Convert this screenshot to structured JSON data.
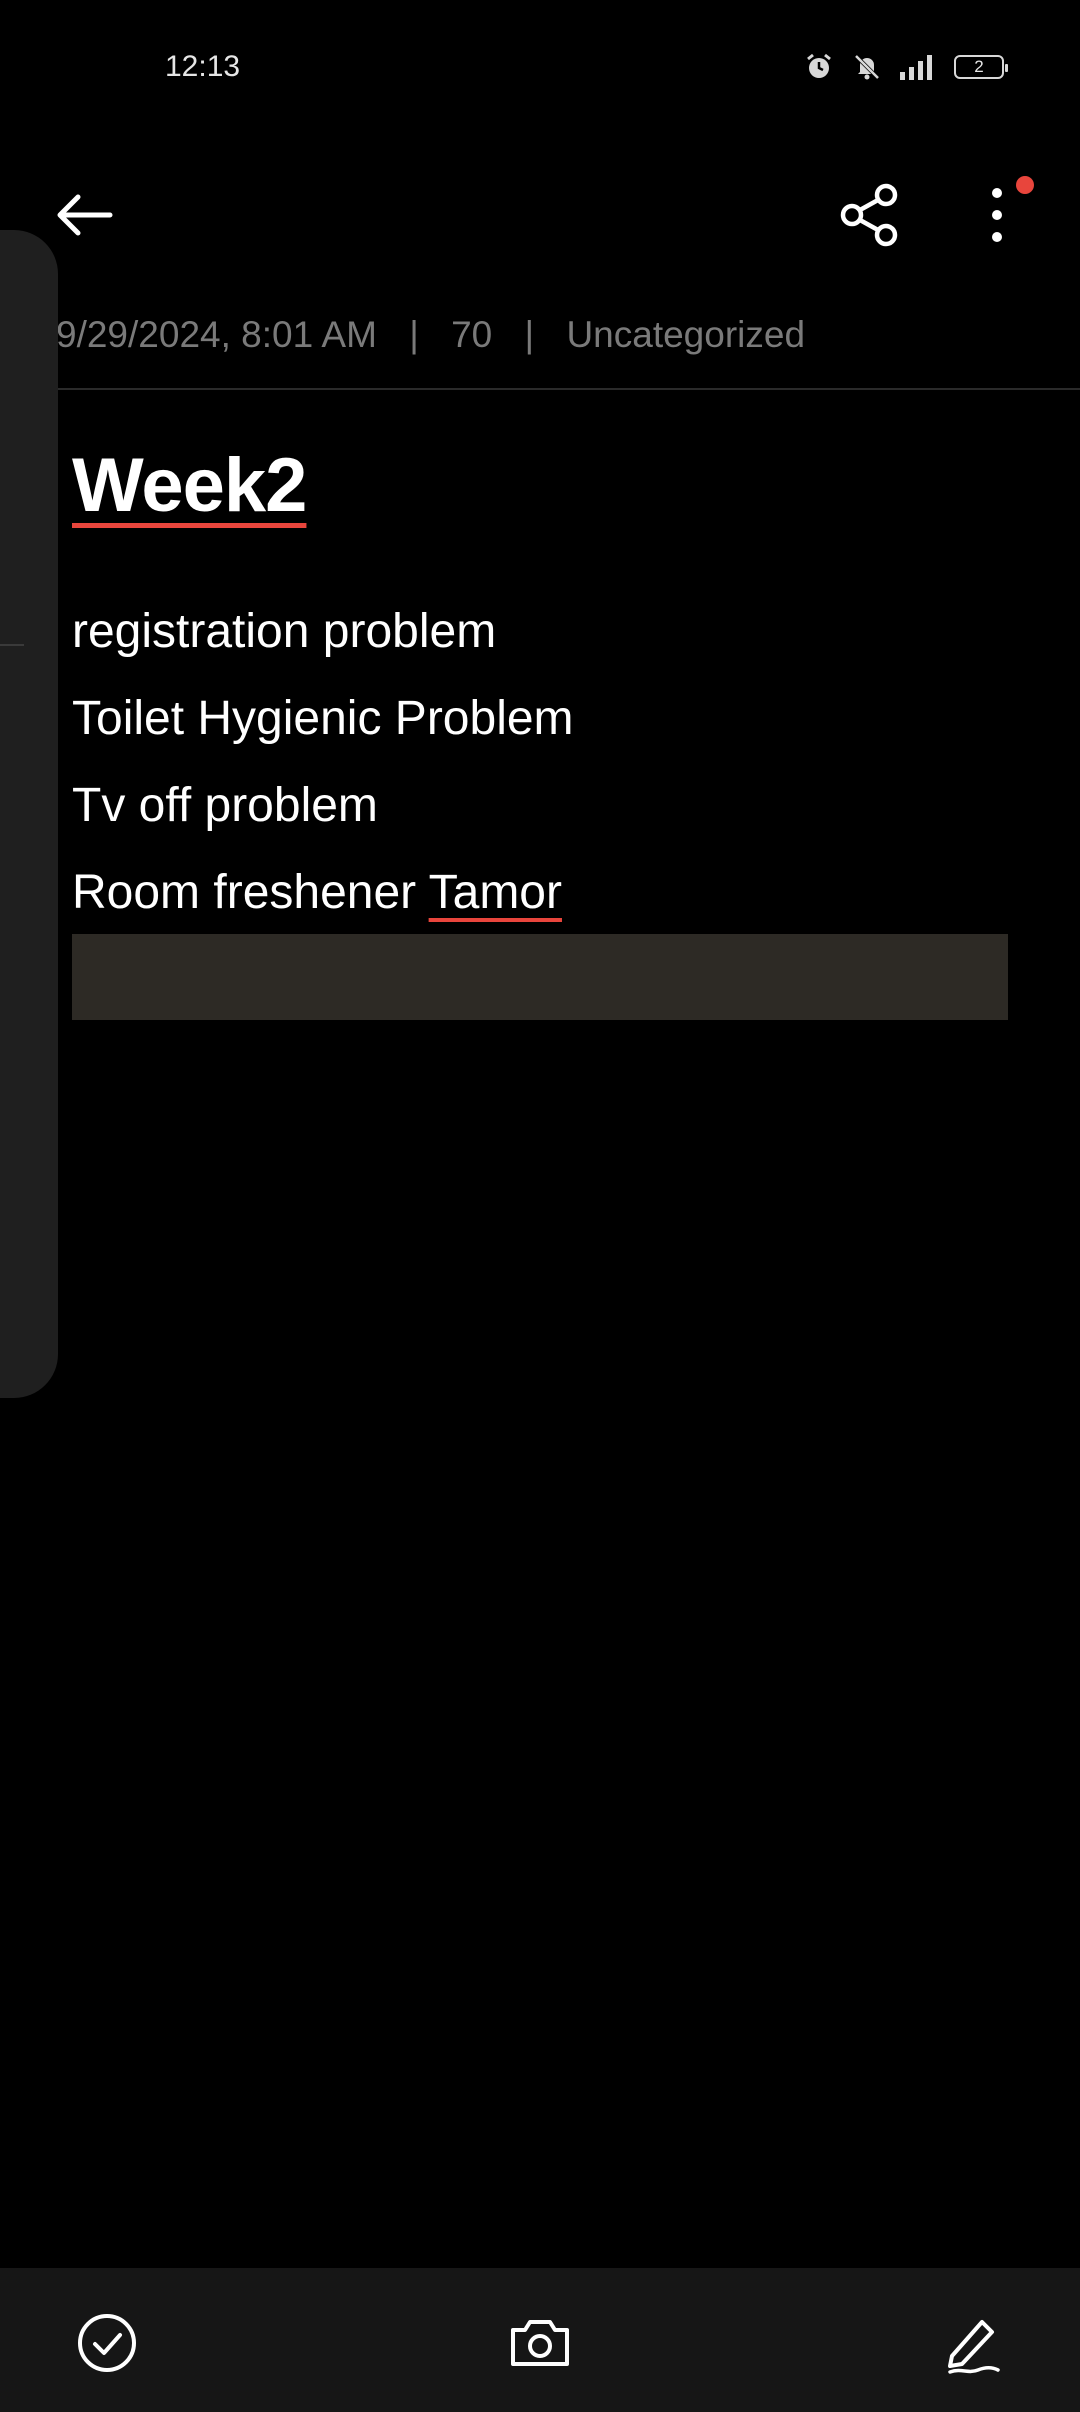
{
  "status_bar": {
    "time": "12:13",
    "battery_level": "2",
    "icons": [
      "alarm-icon",
      "mute-icon",
      "signal-icon",
      "battery-icon"
    ]
  },
  "toolbar": {
    "icons": [
      "back-arrow-icon",
      "share-icon",
      "more-vert-icon"
    ],
    "notification_dot_color": "#e8453c"
  },
  "note": {
    "meta": {
      "date": "9/29/2024, 8:01 AM",
      "count": "70",
      "category": "Uncategorized",
      "separator": "|"
    },
    "title": "Week2",
    "lines": [
      "registration problem",
      "Toilet Hygienic Problem",
      "Tv off problem"
    ],
    "last_line_prefix": "Room freshener ",
    "last_line_word": "Tamor"
  },
  "bottom_bar": {
    "icons": [
      "check-circle-icon",
      "camera-icon",
      "edit-pen-icon"
    ]
  },
  "colors": {
    "background": "#000000",
    "accent_red": "#e8453c",
    "highlight_bar": "#2d2a25",
    "meta_text": "#7a7a7a"
  }
}
